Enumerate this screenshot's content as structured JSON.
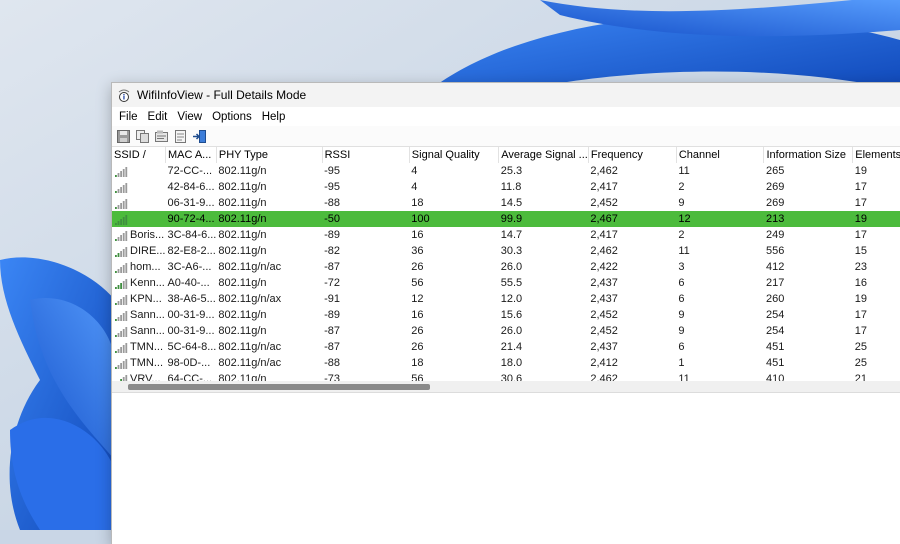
{
  "window": {
    "title": "WifiInfoView  -  Full Details Mode"
  },
  "menu": [
    "File",
    "Edit",
    "View",
    "Options",
    "Help"
  ],
  "toolbar": [
    {
      "icon": "save-icon"
    },
    {
      "icon": "copy-icon"
    },
    {
      "icon": "properties-icon"
    },
    {
      "icon": "html-report-icon"
    },
    {
      "icon": "exit-icon"
    }
  ],
  "columns": [
    "SSID  /",
    "MAC A...",
    "PHY Type",
    "RSSI",
    "Signal Quality",
    "Average Signal ...",
    "Frequency",
    "Channel",
    "Information Size",
    "Elements"
  ],
  "rows": [
    {
      "ssid": "",
      "mac": "72-CC-...",
      "phy": "802.11g/n",
      "rssi": "-95",
      "quality": "4",
      "avg": "25.3",
      "freq": "2,462",
      "channel": "11",
      "info": "265",
      "elements": "19",
      "selected": false
    },
    {
      "ssid": "",
      "mac": "42-84-6...",
      "phy": "802.11g/n",
      "rssi": "-95",
      "quality": "4",
      "avg": "11.8",
      "freq": "2,417",
      "channel": "2",
      "info": "269",
      "elements": "17",
      "selected": false
    },
    {
      "ssid": "",
      "mac": "06-31-9...",
      "phy": "802.11g/n",
      "rssi": "-88",
      "quality": "18",
      "avg": "14.5",
      "freq": "2,452",
      "channel": "9",
      "info": "269",
      "elements": "17",
      "selected": false
    },
    {
      "ssid": "",
      "mac": "90-72-4...",
      "phy": "802.11g/n",
      "rssi": "-50",
      "quality": "100",
      "avg": "99.9",
      "freq": "2,467",
      "channel": "12",
      "info": "213",
      "elements": "19",
      "selected": true
    },
    {
      "ssid": "Boris...",
      "mac": "3C-84-6...",
      "phy": "802.11g/n",
      "rssi": "-89",
      "quality": "16",
      "avg": "14.7",
      "freq": "2,417",
      "channel": "2",
      "info": "249",
      "elements": "17",
      "selected": false
    },
    {
      "ssid": "DIRE...",
      "mac": "82-E8-2...",
      "phy": "802.11g/n",
      "rssi": "-82",
      "quality": "36",
      "avg": "30.3",
      "freq": "2,462",
      "channel": "11",
      "info": "556",
      "elements": "15",
      "selected": false
    },
    {
      "ssid": "hom...",
      "mac": "3C-A6-...",
      "phy": "802.11g/n/ac",
      "rssi": "-87",
      "quality": "26",
      "avg": "26.0",
      "freq": "2,422",
      "channel": "3",
      "info": "412",
      "elements": "23",
      "selected": false
    },
    {
      "ssid": "Kenn...",
      "mac": "A0-40-...",
      "phy": "802.11g/n",
      "rssi": "-72",
      "quality": "56",
      "avg": "55.5",
      "freq": "2,437",
      "channel": "6",
      "info": "217",
      "elements": "16",
      "selected": false
    },
    {
      "ssid": "KPN...",
      "mac": "38-A6-5...",
      "phy": "802.11g/n/ax",
      "rssi": "-91",
      "quality": "12",
      "avg": "12.0",
      "freq": "2,437",
      "channel": "6",
      "info": "260",
      "elements": "19",
      "selected": false
    },
    {
      "ssid": "Sann...",
      "mac": "00-31-9...",
      "phy": "802.11g/n",
      "rssi": "-89",
      "quality": "16",
      "avg": "15.6",
      "freq": "2,452",
      "channel": "9",
      "info": "254",
      "elements": "17",
      "selected": false
    },
    {
      "ssid": "Sann...",
      "mac": "00-31-9...",
      "phy": "802.11g/n",
      "rssi": "-87",
      "quality": "26",
      "avg": "26.0",
      "freq": "2,452",
      "channel": "9",
      "info": "254",
      "elements": "17",
      "selected": false
    },
    {
      "ssid": "TMN...",
      "mac": "5C-64-8...",
      "phy": "802.11g/n/ac",
      "rssi": "-87",
      "quality": "26",
      "avg": "21.4",
      "freq": "2,437",
      "channel": "6",
      "info": "451",
      "elements": "25",
      "selected": false
    },
    {
      "ssid": "TMN...",
      "mac": "98-0D-...",
      "phy": "802.11g/n/ac",
      "rssi": "-88",
      "quality": "18",
      "avg": "18.0",
      "freq": "2,412",
      "channel": "1",
      "info": "451",
      "elements": "25",
      "selected": false
    },
    {
      "ssid": "VRV...",
      "mac": "64-CC-...",
      "phy": "802.11g/n",
      "rssi": "-73",
      "quality": "56",
      "avg": "30.6",
      "freq": "2,462",
      "channel": "11",
      "info": "410",
      "elements": "21",
      "selected": false
    }
  ],
  "colors": {
    "selected_row": "#4cbb3c",
    "wallpaper_blue": "#1a5fd6"
  }
}
